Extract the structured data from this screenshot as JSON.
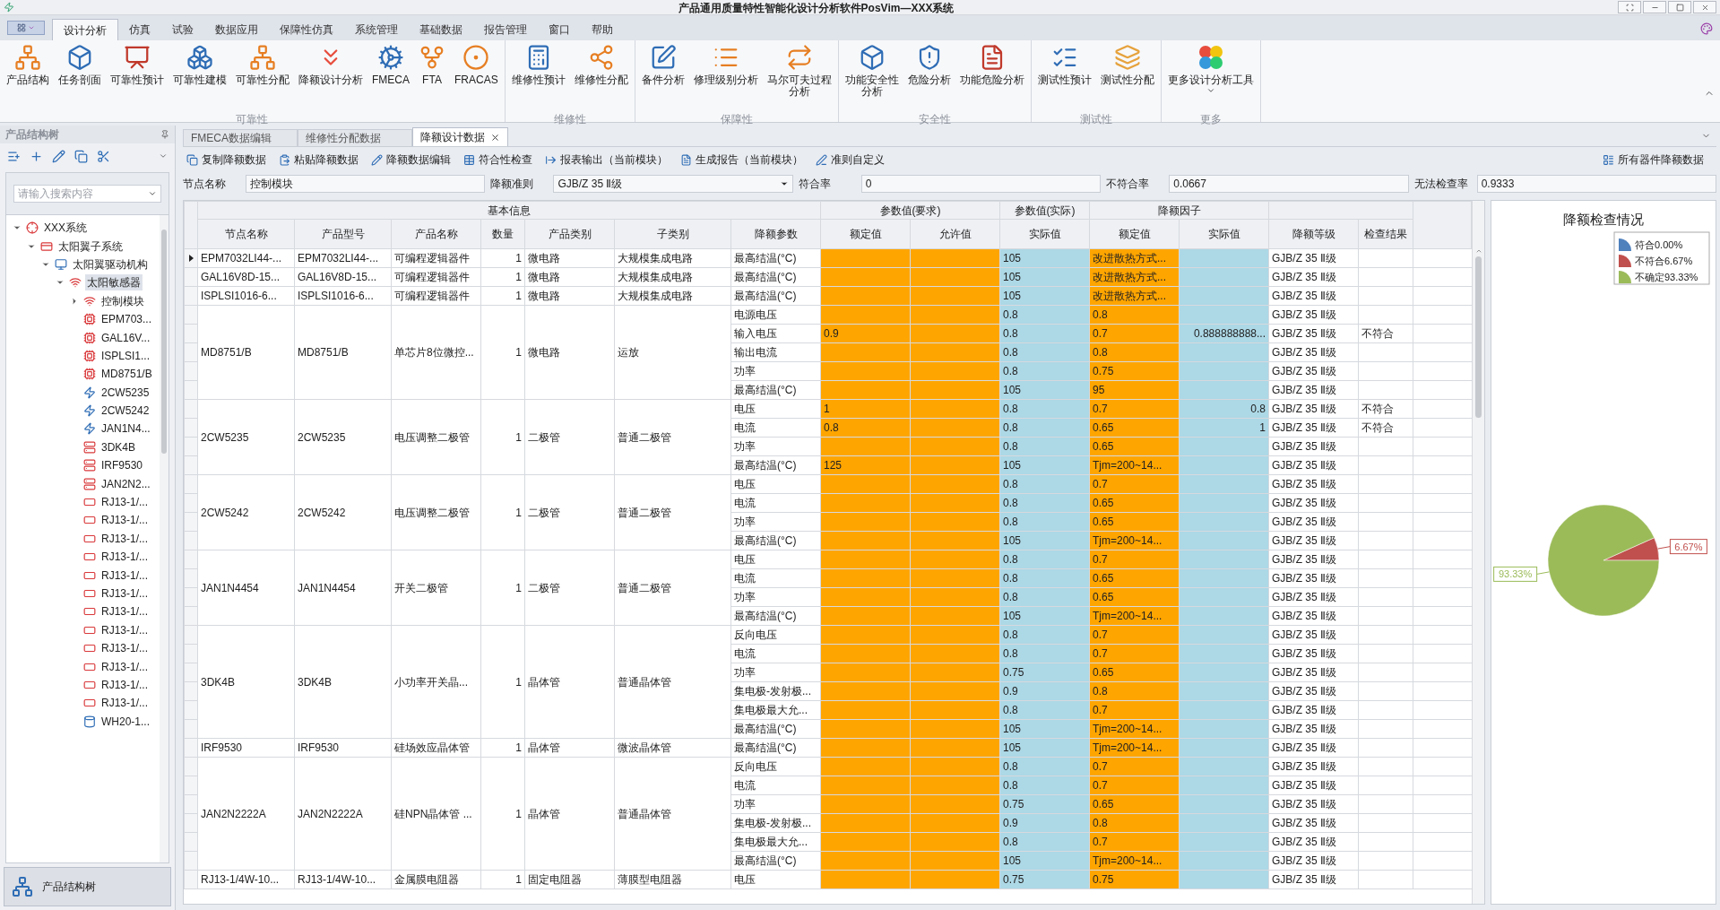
{
  "window": {
    "title": "产品通用质量特性智能化设计分析软件PosVim—XXX系统"
  },
  "menu_tabs": [
    {
      "label": "设计分析",
      "selected": true
    },
    {
      "label": "仿真",
      "selected": false
    },
    {
      "label": "试验",
      "selected": false
    },
    {
      "label": "数据应用",
      "selected": false
    },
    {
      "label": "保障性仿真",
      "selected": false
    },
    {
      "label": "系统管理",
      "selected": false
    },
    {
      "label": "基础数据",
      "selected": false
    },
    {
      "label": "报告管理",
      "selected": false
    },
    {
      "label": "窗口",
      "selected": false
    },
    {
      "label": "帮助",
      "selected": false
    }
  ],
  "ribbon": [
    {
      "label": "可靠性",
      "buttons": [
        {
          "lines": [
            "产品结构"
          ],
          "dropdown": false
        },
        {
          "lines": [
            "任务剖面"
          ],
          "dropdown": false
        },
        {
          "lines": [
            "可靠性预计"
          ],
          "dropdown": false
        },
        {
          "lines": [
            "可靠性建模"
          ],
          "dropdown": false
        },
        {
          "lines": [
            "可靠性分配"
          ],
          "dropdown": false
        },
        {
          "lines": [
            "降额设计分析"
          ],
          "dropdown": false
        },
        {
          "lines": [
            "FMECA"
          ],
          "dropdown": false
        },
        {
          "lines": [
            "FTA"
          ],
          "dropdown": false
        },
        {
          "lines": [
            "FRACAS"
          ],
          "dropdown": false
        }
      ]
    },
    {
      "label": "维修性",
      "buttons": [
        {
          "lines": [
            "维修性预计"
          ],
          "dropdown": false
        },
        {
          "lines": [
            "维修性分配"
          ],
          "dropdown": false
        }
      ]
    },
    {
      "label": "保障性",
      "buttons": [
        {
          "lines": [
            "备件分析"
          ],
          "dropdown": false
        },
        {
          "lines": [
            "修理级别分析"
          ],
          "dropdown": false
        },
        {
          "lines": [
            "马尔可夫过程",
            "分析"
          ],
          "dropdown": false
        }
      ]
    },
    {
      "label": "安全性",
      "buttons": [
        {
          "lines": [
            "功能安全性",
            "分析"
          ],
          "dropdown": false
        },
        {
          "lines": [
            "危险分析"
          ],
          "dropdown": false
        },
        {
          "lines": [
            "功能危险分析"
          ],
          "dropdown": false
        }
      ]
    },
    {
      "label": "测试性",
      "buttons": [
        {
          "lines": [
            "测试性预计"
          ],
          "dropdown": false
        },
        {
          "lines": [
            "测试性分配"
          ],
          "dropdown": false
        }
      ]
    },
    {
      "label": "更多",
      "buttons": [
        {
          "lines": [
            "更多设计分析工具"
          ],
          "dropdown": true
        }
      ]
    }
  ],
  "tree": {
    "title": "产品结构树",
    "search_placeholder": "请输入搜索内容",
    "footer": "产品结构树",
    "items": [
      {
        "label": "XXX系统",
        "kind": "system",
        "selected": false,
        "expanded": true,
        "children": [
          {
            "label": "太阳翼子系统",
            "kind": "subsystem",
            "selected": false,
            "expanded": true,
            "children": [
              {
                "label": "太阳翼驱动机构",
                "kind": "mechanism",
                "selected": false,
                "expanded": true,
                "children": [
                  {
                    "label": "太阳敏感器",
                    "kind": "sensor",
                    "selected": true,
                    "expanded": true,
                    "children": [
                      {
                        "label": "控制模块",
                        "kind": "sensor",
                        "selected": false,
                        "expanded": false
                      },
                      {
                        "label": "EPM703...",
                        "kind": "ic",
                        "selected": false
                      },
                      {
                        "label": "GAL16V...",
                        "kind": "ic",
                        "selected": false
                      },
                      {
                        "label": "ISPLSI1...",
                        "kind": "ic",
                        "selected": false
                      },
                      {
                        "label": "MD8751/B",
                        "kind": "ic",
                        "selected": false
                      },
                      {
                        "label": "2CW5235",
                        "kind": "diode",
                        "selected": false
                      },
                      {
                        "label": "2CW5242",
                        "kind": "diode",
                        "selected": false
                      },
                      {
                        "label": "JAN1N4...",
                        "kind": "diode",
                        "selected": false
                      },
                      {
                        "label": "3DK4B",
                        "kind": "transistor",
                        "selected": false
                      },
                      {
                        "label": "IRF9530",
                        "kind": "transistor",
                        "selected": false
                      },
                      {
                        "label": "JAN2N2...",
                        "kind": "transistor",
                        "selected": false
                      },
                      {
                        "label": "RJ13-1/...",
                        "kind": "resistor",
                        "selected": false
                      },
                      {
                        "label": "RJ13-1/...",
                        "kind": "resistor",
                        "selected": false
                      },
                      {
                        "label": "RJ13-1/...",
                        "kind": "resistor",
                        "selected": false
                      },
                      {
                        "label": "RJ13-1/...",
                        "kind": "resistor",
                        "selected": false
                      },
                      {
                        "label": "RJ13-1/...",
                        "kind": "resistor",
                        "selected": false
                      },
                      {
                        "label": "RJ13-1/...",
                        "kind": "resistor",
                        "selected": false
                      },
                      {
                        "label": "RJ13-1/...",
                        "kind": "resistor",
                        "selected": false
                      },
                      {
                        "label": "RJ13-1/...",
                        "kind": "resistor",
                        "selected": false
                      },
                      {
                        "label": "RJ13-1/...",
                        "kind": "resistor",
                        "selected": false
                      },
                      {
                        "label": "RJ13-1/...",
                        "kind": "resistor",
                        "selected": false
                      },
                      {
                        "label": "RJ13-1/...",
                        "kind": "resistor",
                        "selected": false
                      },
                      {
                        "label": "RJ13-1/...",
                        "kind": "resistor",
                        "selected": false
                      },
                      {
                        "label": "WH20-1...",
                        "kind": "potentiometer",
                        "selected": false
                      }
                    ]
                  }
                ]
              }
            ]
          }
        ]
      }
    ]
  },
  "doc_tabs": [
    {
      "label": "FMECA数据编辑",
      "selected": false
    },
    {
      "label": "维修性分配数据",
      "selected": false
    },
    {
      "label": "降额设计数据",
      "selected": true
    }
  ],
  "toolbar": [
    {
      "label": "复制降额数据"
    },
    {
      "label": "粘贴降额数据"
    },
    {
      "label": "降额数据编辑"
    },
    {
      "label": "符合性检查"
    },
    {
      "label": "报表输出（当前模块）"
    },
    {
      "label": "生成报告（当前模块）"
    },
    {
      "label": "准则自定义"
    }
  ],
  "toolbar_right": {
    "label": "所有器件降额数据"
  },
  "fields": [
    {
      "label": "节点名称",
      "value": "控制模块",
      "kind": "text"
    },
    {
      "label": "降额准则",
      "value": "GJB/Z 35 Ⅱ级",
      "kind": "select"
    },
    {
      "label": "符合率",
      "value": "0",
      "kind": "text"
    },
    {
      "label": "不符合率",
      "value": "0.0667",
      "kind": "text"
    },
    {
      "label": "无法检查率",
      "value": "0.9333",
      "kind": "text"
    }
  ],
  "table": {
    "header_groups": [
      {
        "label": "基本信息",
        "columns": [
          "节点名称",
          "产品型号",
          "产品名称",
          "数量",
          "产品类别",
          "子类别",
          "降额参数"
        ]
      },
      {
        "label": "参数值(要求)",
        "columns": [
          "额定值",
          "允许值"
        ]
      },
      {
        "label": "参数值(实际)",
        "columns": [
          "实际值"
        ]
      },
      {
        "label": "降额因子",
        "columns": [
          "额定值",
          "实际值"
        ]
      }
    ],
    "columns_extra": [
      "降额等级",
      "检查结果"
    ],
    "groups": [
      {
        "selected": true,
        "node": "EPM7032LI44-...",
        "model": "EPM7032LI44-...",
        "name": "可编程逻辑器件",
        "qty": "1",
        "category": "微电路",
        "subcategory": "大规模集成电路",
        "params": [
          {
            "param": "最高结温(°C)",
            "actual": "105",
            "factor_rated": "改进散热方式...",
            "grade": "GJB/Z 35 Ⅱ级"
          }
        ]
      },
      {
        "selected": false,
        "node": "GAL16V8D-15...",
        "model": "GAL16V8D-15...",
        "name": "可编程逻辑器件",
        "qty": "1",
        "category": "微电路",
        "subcategory": "大规模集成电路",
        "params": [
          {
            "param": "最高结温(°C)",
            "actual": "105",
            "factor_rated": "改进散热方式...",
            "grade": "GJB/Z 35 Ⅱ级"
          }
        ]
      },
      {
        "selected": false,
        "node": "ISPLSI1016-6...",
        "model": "ISPLSI1016-6...",
        "name": "可编程逻辑器件",
        "qty": "1",
        "category": "微电路",
        "subcategory": "大规模集成电路",
        "params": [
          {
            "param": "最高结温(°C)",
            "actual": "105",
            "factor_rated": "改进散热方式...",
            "grade": "GJB/Z 35 Ⅱ级"
          }
        ]
      },
      {
        "selected": false,
        "node": "MD8751/B",
        "model": "MD8751/B",
        "name": "单芯片8位微控...",
        "qty": "1",
        "category": "微电路",
        "subcategory": "运放",
        "params": [
          {
            "param": "电源电压",
            "actual": "0.8",
            "factor_rated": "0.8",
            "grade": "GJB/Z 35 Ⅱ级"
          },
          {
            "param": "输入电压",
            "rated": "0.9",
            "actual": "0.8",
            "factor_rated": "0.7",
            "factor_actual": "0.888888888...",
            "grade": "GJB/Z 35 Ⅱ级",
            "result": "不符合"
          },
          {
            "param": "输出电流",
            "actual": "0.8",
            "factor_rated": "0.8",
            "grade": "GJB/Z 35 Ⅱ级"
          },
          {
            "param": "功率",
            "actual": "0.8",
            "factor_rated": "0.75",
            "grade": "GJB/Z 35 Ⅱ级"
          },
          {
            "param": "最高结温(°C)",
            "actual": "105",
            "factor_rated": "95",
            "grade": "GJB/Z 35 Ⅱ级"
          }
        ]
      },
      {
        "selected": false,
        "node": "2CW5235",
        "model": "2CW5235",
        "name": "电压调整二极管",
        "qty": "1",
        "category": "二极管",
        "subcategory": "普通二极管",
        "params": [
          {
            "param": "电压",
            "rated": "1",
            "actual": "0.8",
            "factor_rated": "0.7",
            "factor_actual": "0.8",
            "grade": "GJB/Z 35 Ⅱ级",
            "result": "不符合"
          },
          {
            "param": "电流",
            "rated": "0.8",
            "actual": "0.8",
            "factor_rated": "0.65",
            "factor_actual": "1",
            "grade": "GJB/Z 35 Ⅱ级",
            "result": "不符合"
          },
          {
            "param": "功率",
            "actual": "0.8",
            "factor_rated": "0.65",
            "grade": "GJB/Z 35 Ⅱ级"
          },
          {
            "param": "最高结温(°C)",
            "rated": "125",
            "actual": "105",
            "factor_rated": "Tjm=200~14...",
            "grade": "GJB/Z 35 Ⅱ级"
          }
        ]
      },
      {
        "selected": false,
        "node": "2CW5242",
        "model": "2CW5242",
        "name": "电压调整二极管",
        "qty": "1",
        "category": "二极管",
        "subcategory": "普通二极管",
        "params": [
          {
            "param": "电压",
            "actual": "0.8",
            "factor_rated": "0.7",
            "grade": "GJB/Z 35 Ⅱ级"
          },
          {
            "param": "电流",
            "actual": "0.8",
            "factor_rated": "0.65",
            "grade": "GJB/Z 35 Ⅱ级"
          },
          {
            "param": "功率",
            "actual": "0.8",
            "factor_rated": "0.65",
            "grade": "GJB/Z 35 Ⅱ级"
          },
          {
            "param": "最高结温(°C)",
            "actual": "105",
            "factor_rated": "Tjm=200~14...",
            "grade": "GJB/Z 35 Ⅱ级"
          }
        ]
      },
      {
        "selected": false,
        "node": "JAN1N4454",
        "model": "JAN1N4454",
        "name": "开关二极管",
        "qty": "1",
        "category": "二极管",
        "subcategory": "普通二极管",
        "params": [
          {
            "param": "电压",
            "actual": "0.8",
            "factor_rated": "0.7",
            "grade": "GJB/Z 35 Ⅱ级"
          },
          {
            "param": "电流",
            "actual": "0.8",
            "factor_rated": "0.65",
            "grade": "GJB/Z 35 Ⅱ级"
          },
          {
            "param": "功率",
            "actual": "0.8",
            "factor_rated": "0.65",
            "grade": "GJB/Z 35 Ⅱ级"
          },
          {
            "param": "最高结温(°C)",
            "actual": "105",
            "factor_rated": "Tjm=200~14...",
            "grade": "GJB/Z 35 Ⅱ级"
          }
        ]
      },
      {
        "selected": false,
        "node": "3DK4B",
        "model": "3DK4B",
        "name": "小功率开关晶...",
        "qty": "1",
        "category": "晶体管",
        "subcategory": "普通晶体管",
        "params": [
          {
            "param": "反向电压",
            "actual": "0.8",
            "factor_rated": "0.7",
            "grade": "GJB/Z 35 Ⅱ级"
          },
          {
            "param": "电流",
            "actual": "0.8",
            "factor_rated": "0.7",
            "grade": "GJB/Z 35 Ⅱ级"
          },
          {
            "param": "功率",
            "actual": "0.75",
            "factor_rated": "0.65",
            "grade": "GJB/Z 35 Ⅱ级"
          },
          {
            "param": "集电极-发射极...",
            "actual": "0.9",
            "factor_rated": "0.8",
            "grade": "GJB/Z 35 Ⅱ级"
          },
          {
            "param": "集电极最大允...",
            "actual": "0.8",
            "factor_rated": "0.7",
            "grade": "GJB/Z 35 Ⅱ级"
          },
          {
            "param": "最高结温(°C)",
            "actual": "105",
            "factor_rated": "Tjm=200~14...",
            "grade": "GJB/Z 35 Ⅱ级"
          }
        ]
      },
      {
        "selected": false,
        "node": "IRF9530",
        "model": "IRF9530",
        "name": "硅场效应晶体管",
        "qty": "1",
        "category": "晶体管",
        "subcategory": "微波晶体管",
        "params": [
          {
            "param": "最高结温(°C)",
            "actual": "105",
            "factor_rated": "Tjm=200~14...",
            "grade": "GJB/Z 35 Ⅱ级"
          }
        ]
      },
      {
        "selected": false,
        "node": "JAN2N2222A",
        "model": "JAN2N2222A",
        "name": "硅NPN晶体管 ...",
        "qty": "1",
        "category": "晶体管",
        "subcategory": "普通晶体管",
        "params": [
          {
            "param": "反向电压",
            "actual": "0.8",
            "factor_rated": "0.7",
            "grade": "GJB/Z 35 Ⅱ级"
          },
          {
            "param": "电流",
            "actual": "0.8",
            "factor_rated": "0.7",
            "grade": "GJB/Z 35 Ⅱ级"
          },
          {
            "param": "功率",
            "actual": "0.75",
            "factor_rated": "0.65",
            "grade": "GJB/Z 35 Ⅱ级"
          },
          {
            "param": "集电极-发射极...",
            "actual": "0.9",
            "factor_rated": "0.8",
            "grade": "GJB/Z 35 Ⅱ级"
          },
          {
            "param": "集电极最大允...",
            "actual": "0.8",
            "factor_rated": "0.7",
            "grade": "GJB/Z 35 Ⅱ级"
          },
          {
            "param": "最高结温(°C)",
            "actual": "105",
            "factor_rated": "Tjm=200~14...",
            "grade": "GJB/Z 35 Ⅱ级"
          }
        ]
      },
      {
        "selected": false,
        "node": "RJ13-1/4W-10...",
        "model": "RJ13-1/4W-10...",
        "name": "金属膜电阻器",
        "qty": "1",
        "category": "固定电阻器",
        "subcategory": "薄膜型电阻器",
        "params": [
          {
            "param": "电压",
            "actual": "0.75",
            "factor_rated": "0.75",
            "grade": "GJB/Z 35 Ⅱ级"
          }
        ]
      }
    ]
  },
  "chart_panel": {
    "chart_data": {
      "type": "pie",
      "title": "降额检查情况",
      "legend": "upper right",
      "categories": [
        "符合0.00%",
        "不符合6.67%",
        "不确定93.33%"
      ],
      "values": [
        0,
        6.67,
        93.33
      ],
      "colors": [
        "#4f81bd",
        "#c0504d",
        "#9bbb59"
      ],
      "value_labels": [
        null,
        "6.67%",
        "93.33%"
      ]
    }
  }
}
